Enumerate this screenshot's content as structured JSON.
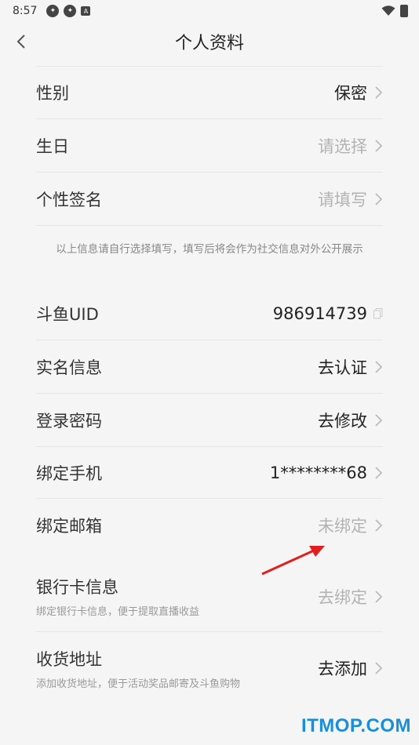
{
  "statusbar": {
    "time": "8:57",
    "letter_icon": "A"
  },
  "header": {
    "title": "个人资料"
  },
  "rows_top": [
    {
      "label": "性别",
      "value": "保密",
      "muted": false
    },
    {
      "label": "生日",
      "value": "请选择",
      "muted": true
    },
    {
      "label": "个性签名",
      "value": "请填写",
      "muted": true
    }
  ],
  "note": "以上信息请自行选择填写，填写后将会作为社交信息对外公开展示",
  "uid": {
    "label": "斗鱼UID",
    "value": "986914739"
  },
  "realname": {
    "label": "实名信息",
    "value": "去认证"
  },
  "password": {
    "label": "登录密码",
    "value": "去修改"
  },
  "phone": {
    "label": "绑定手机",
    "value": "1********68"
  },
  "email": {
    "label": "绑定邮箱",
    "value": "未绑定"
  },
  "bank": {
    "label": "银行卡信息",
    "sub": "绑定银行卡信息，便于提取直播收益",
    "value": "去绑定"
  },
  "address": {
    "label": "收货地址",
    "sub": "添加收货地址，便于活动奖品邮寄及斗鱼购物",
    "value": "去添加"
  },
  "watermark": "ITMOP.COM",
  "colors": {
    "background": "#f5f5f5",
    "muted_text": "#b3b3b3",
    "annotation_arrow": "#e02020",
    "watermark": "#1a8fd8"
  }
}
